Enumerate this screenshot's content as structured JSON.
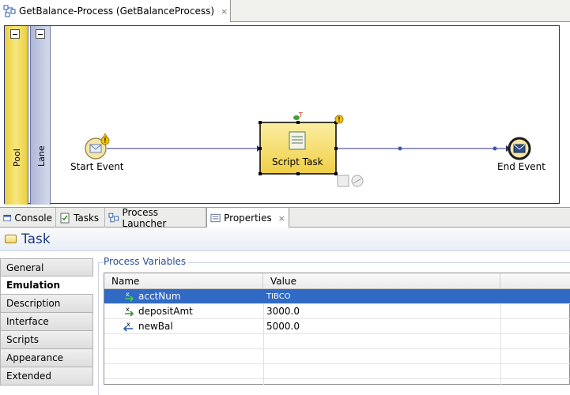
{
  "editor": {
    "tab_title": "GetBalance-Process (GetBalanceProcess)",
    "close_glyph": "×"
  },
  "diagram": {
    "pool_label": "Pool",
    "lane_label": "Lane",
    "start_event_label": "Start Event",
    "script_task_label": "Script Task",
    "end_event_label": "End Event",
    "colors": {
      "pool": "#e9cf3d",
      "lane": "#b9c1dd",
      "task_fill": "#f7e27a",
      "flow_line": "#2a2f7a"
    }
  },
  "views": {
    "tabs": [
      {
        "label": "Console",
        "icon": "console-icon"
      },
      {
        "label": "Tasks",
        "icon": "tasks-icon"
      },
      {
        "label": "Process Launcher",
        "icon": "process-launcher-icon"
      },
      {
        "label": "Properties",
        "icon": "properties-icon"
      }
    ],
    "active": "Properties",
    "close_glyph": "×"
  },
  "properties": {
    "title": "Task",
    "side_tabs": [
      "General",
      "Emulation",
      "Description",
      "Interface",
      "Scripts",
      "Appearance",
      "Extended"
    ],
    "active_side_tab": "Emulation",
    "group_label": "Process Variables",
    "table": {
      "columns": [
        "Name",
        "Value"
      ],
      "rows": [
        {
          "name": "acctNum",
          "value": "TIBCO",
          "direction": "in",
          "selected": true
        },
        {
          "name": "depositAmt",
          "value": "3000.0",
          "direction": "in",
          "selected": false
        },
        {
          "name": "newBal",
          "value": "5000.0",
          "direction": "out",
          "selected": false
        }
      ]
    }
  }
}
